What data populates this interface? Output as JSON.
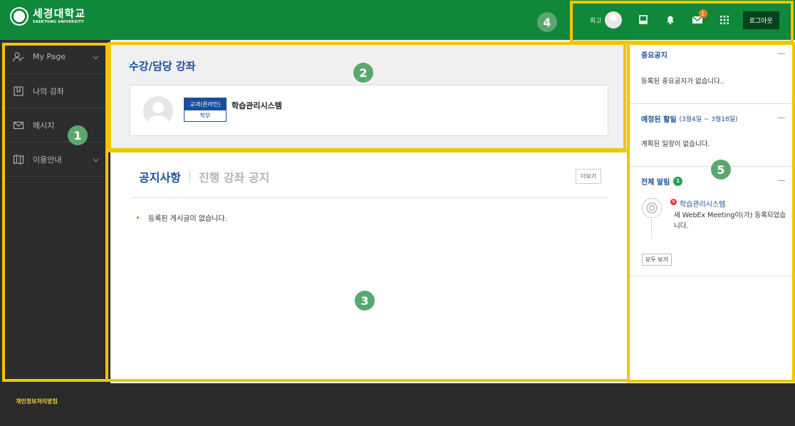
{
  "header": {
    "logo_name": "세경대학교",
    "logo_sub": "SAEKYUNG UNIVERSITY",
    "user_name": "최고",
    "logout_label": "로그아웃",
    "message_badge": "1"
  },
  "sidebar": {
    "items": [
      {
        "label": "My Page",
        "icon": "user-icon"
      },
      {
        "label": "나의 강좌",
        "icon": "book-icon"
      },
      {
        "label": "메시지",
        "icon": "mail-icon"
      },
      {
        "label": "이용안내",
        "icon": "map-icon"
      }
    ]
  },
  "course": {
    "title": "수강/담당 강좌",
    "tag_type": "교과(온라인)",
    "tag_level": "학부",
    "name": "학습관리시스템"
  },
  "notice": {
    "tab_active": "공지사항",
    "tab_inactive": "진행 강좌 공지",
    "more_label": "더보기",
    "empty": "등록된 게시글이 없습니다."
  },
  "right": {
    "important_title": "중요공지",
    "important_empty": "등록된 중요공지가 없습니다..",
    "schedule_title": "예정된 할일",
    "schedule_range": "(3월4일 ~ 3월18일)",
    "schedule_empty": "계획된 일정이 없습니다.",
    "alerts_title": "전체 알림",
    "alerts_count": "1",
    "alert_badge": "N",
    "alert_source": "학습관리시스템",
    "alert_text": "새 WebEx Meeting이(가) 등록되었습니다.",
    "see_all_label": "모두 보기"
  },
  "footer": {
    "privacy": "개인정보처리방침"
  },
  "annotations": [
    "1",
    "2",
    "3",
    "4",
    "5"
  ],
  "colors": {
    "header_green": "#10883a",
    "accent_blue": "#1a4f9c",
    "highlight_yellow": "#f2c500",
    "marker_green": "#5aa870"
  }
}
